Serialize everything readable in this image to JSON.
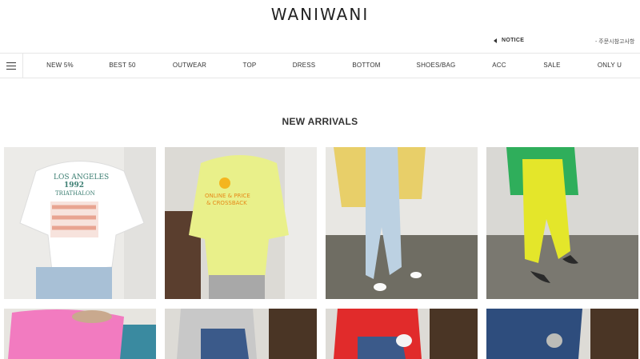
{
  "header": {
    "logo": "WANIWANI",
    "notice_label": "NOTICE",
    "notice_text": "- 주문시참고사항"
  },
  "nav": {
    "menu_icon": "hamburger-menu-icon",
    "items": [
      {
        "label": "NEW 5%"
      },
      {
        "label": "BEST 50"
      },
      {
        "label": "OUTWEAR"
      },
      {
        "label": "TOP"
      },
      {
        "label": "DRESS"
      },
      {
        "label": "BOTTOM"
      },
      {
        "label": "SHOES/BAG"
      },
      {
        "label": "ACC"
      },
      {
        "label": "SALE"
      },
      {
        "label": "ONLY U"
      }
    ]
  },
  "section": {
    "title": "NEW ARRIVALS"
  },
  "products": {
    "row1": [
      {
        "graphic_text_1": "LOS ANGELES",
        "graphic_text_2": "1992",
        "graphic_text_3": "TRIATHALON"
      },
      {
        "graphic_text_1": "ONLINE & PRICE",
        "graphic_text_2": "& CROSSBACK"
      },
      {},
      {}
    ]
  },
  "colors": {
    "accent": "#222222",
    "border": "#e6e6e6"
  }
}
